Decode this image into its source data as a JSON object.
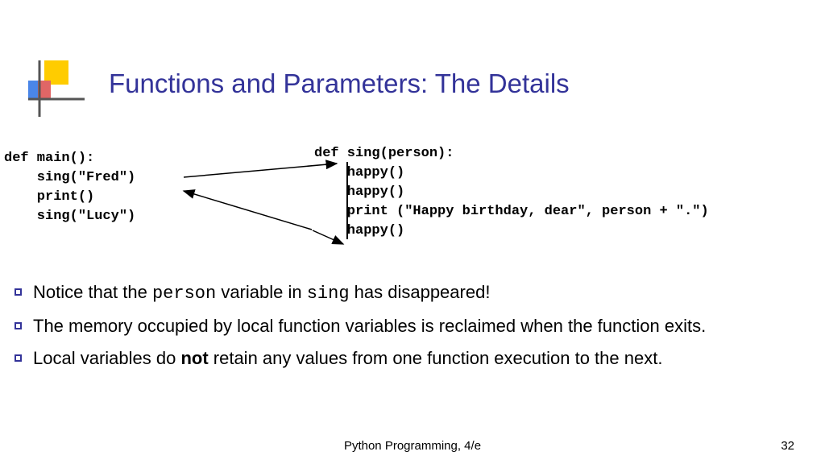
{
  "title": "Functions and Parameters: The Details",
  "code_left": "def main():\n    sing(\"Fred\")\n    print()\n    sing(\"Lucy\")",
  "code_right": "def sing(person):\n    happy()\n    happy()\n    print (\"Happy birthday, dear\", person + \".\")\n    happy()",
  "bullets": [
    {
      "pre": "Notice that the ",
      "mono1": "person",
      "mid": " variable in ",
      "mono2": "sing",
      "post": " has disappeared!"
    },
    {
      "text": "The memory occupied by local function variables is reclaimed when the function exits."
    },
    {
      "pre": "Local variables do ",
      "bold": "not",
      "post": " retain any values from one function execution to the next."
    }
  ],
  "footer": {
    "book": "Python Programming, 4/e",
    "page": "32"
  }
}
